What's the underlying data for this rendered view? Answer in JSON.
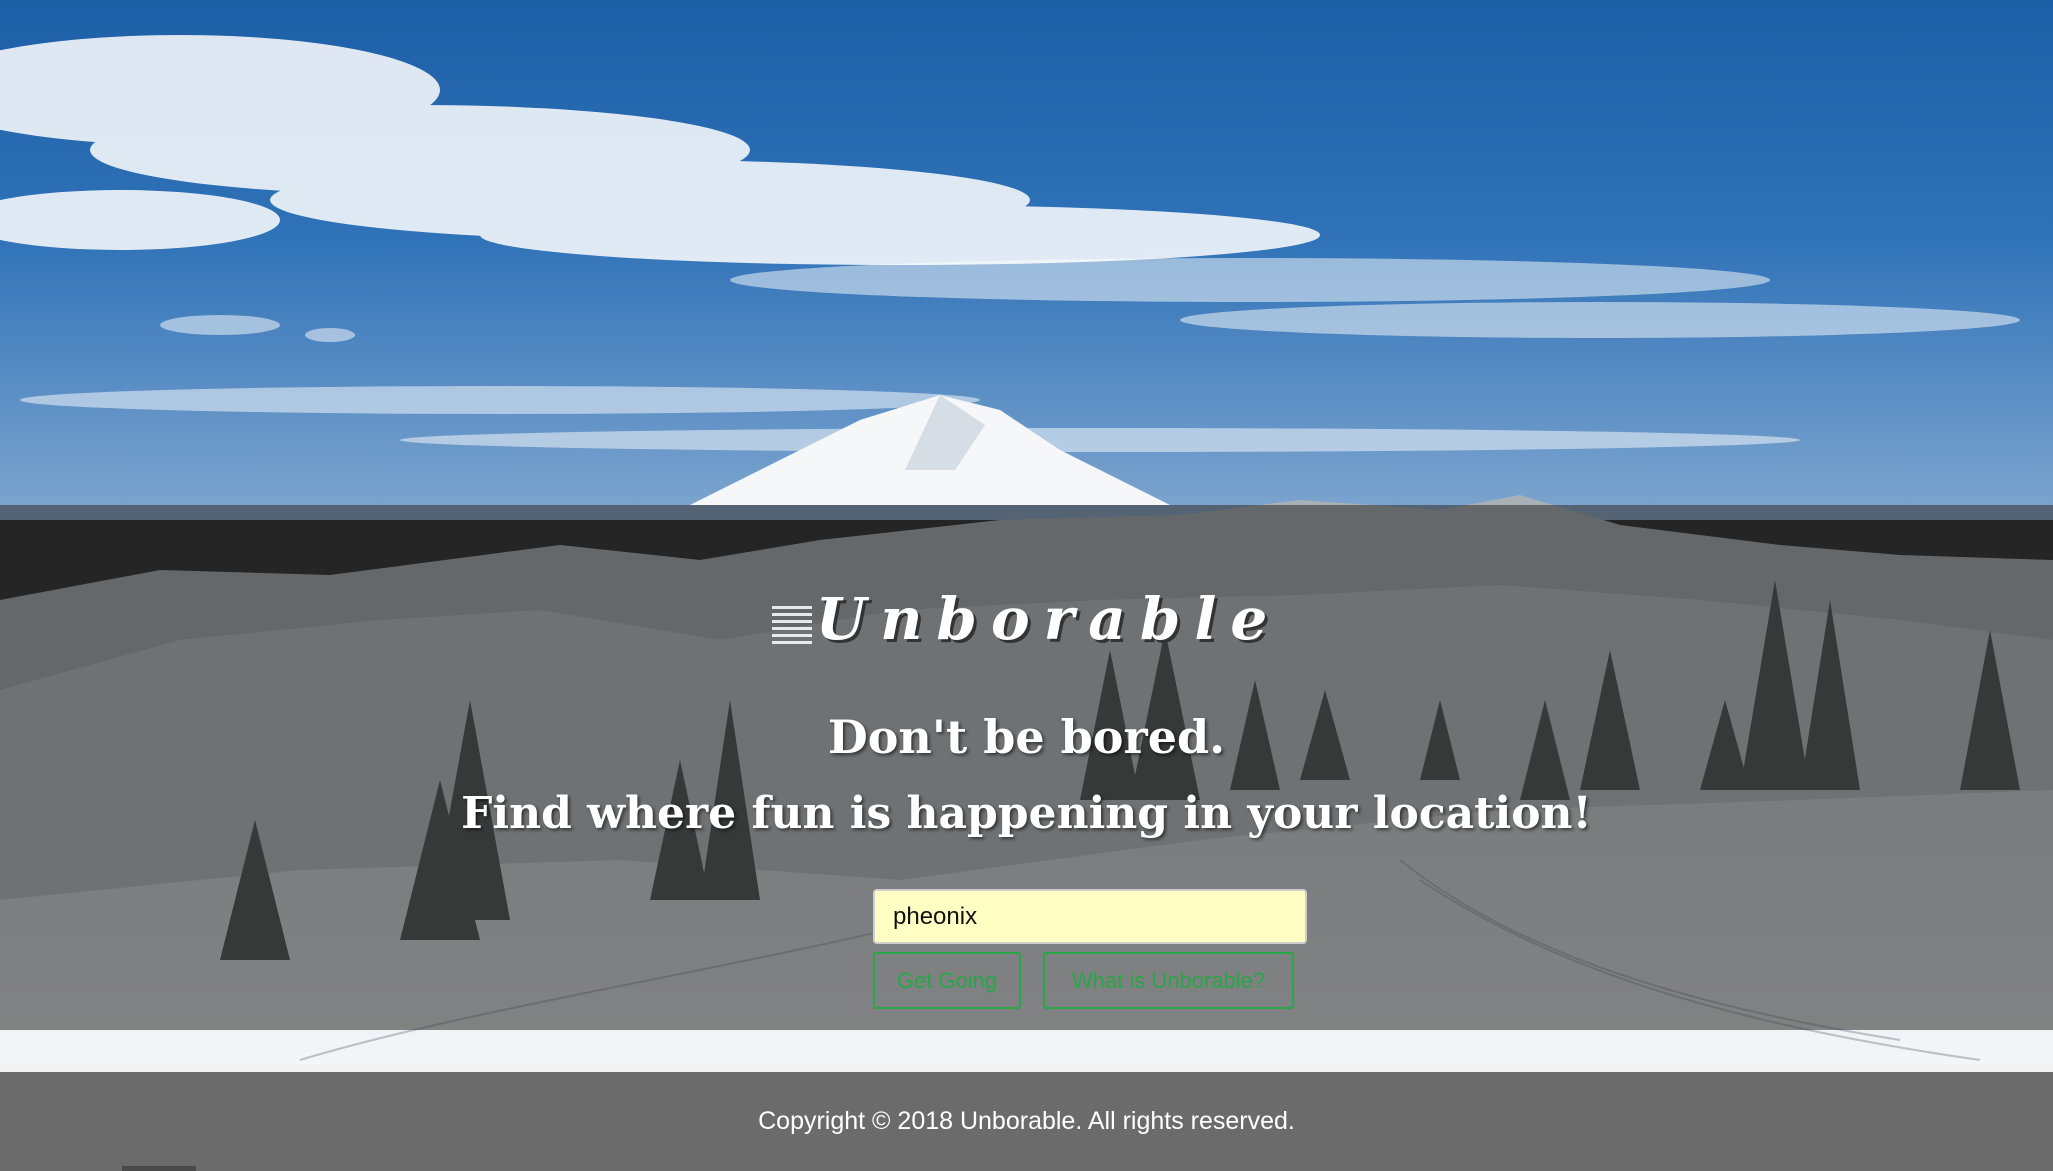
{
  "brand": {
    "logo_text": "Unborable"
  },
  "hero": {
    "tagline_line1": "Don't be bored.",
    "tagline_line2": "Find where fun is happening in your location!"
  },
  "search": {
    "value": "pheonix",
    "placeholder": ""
  },
  "buttons": {
    "get_going_label": "Get Going",
    "what_is_label": "What is Unborable?"
  },
  "footer": {
    "copyright": "Copyright © 2018 Unborable. All rights reserved."
  },
  "colors": {
    "accent_green": "#27a745",
    "input_bg": "#ffffc4",
    "overlay": "#3c3c3c",
    "footer_bg": "#6b6b6b",
    "sky_top": "#1d5fa6"
  },
  "background": {
    "scene_icon": "snowy-mountain-landscape"
  }
}
